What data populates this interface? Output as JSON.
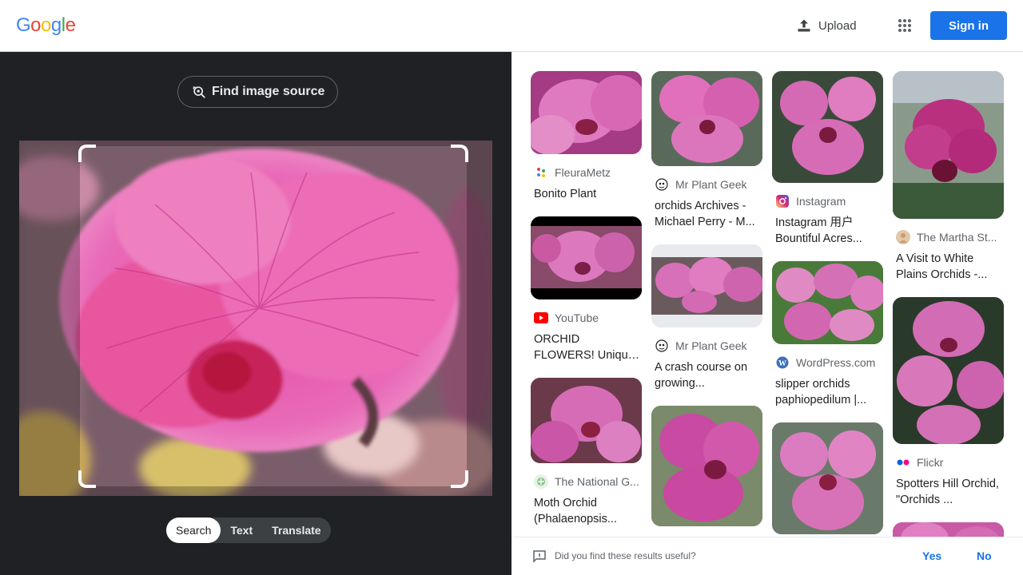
{
  "header": {
    "logo_letters": [
      "G",
      "o",
      "o",
      "g",
      "l",
      "e"
    ],
    "logo_colors": [
      "#4285F4",
      "#EA4335",
      "#FBBC05",
      "#4285F4",
      "#34A853",
      "#EA4335"
    ],
    "upload_label": "Upload",
    "apps_icon": "apps-grid-icon",
    "signin_label": "Sign in"
  },
  "lens": {
    "find_source_label": "Find image source",
    "modes": [
      "Search",
      "Text",
      "Translate"
    ],
    "active_mode": "Search"
  },
  "results": [
    {
      "source": "FleuraMetz",
      "title": "Bonito Plant",
      "fav": "fleurametz-icon"
    },
    {
      "source": "YouTube",
      "title": "ORCHID FLOWERS! Unique! - YouTube",
      "fav": "youtube-icon"
    },
    {
      "source": "The National G...",
      "title": "Moth Orchid (Phalaenopsis...",
      "fav": "national-garden-icon"
    },
    {
      "source": "Mr Plant Geek",
      "title": "orchids Archives - Michael Perry - M...",
      "fav": "mr-plant-geek-icon"
    },
    {
      "source": "Mr Plant Geek",
      "title": "A crash course on growing...",
      "fav": "mr-plant-geek-icon"
    },
    {
      "source": "",
      "title": "",
      "fav": ""
    },
    {
      "source": "Instagram",
      "title": "Instagram 用户 Bountiful Acres...",
      "fav": "instagram-icon"
    },
    {
      "source": "WordPress.com",
      "title": "slipper orchids paphiopedilum |...",
      "fav": "wordpress-icon"
    },
    {
      "source": "",
      "title": "",
      "fav": ""
    },
    {
      "source": "The Martha St...",
      "title": "A Visit to White Plains Orchids -...",
      "fav": "martha-stewart-icon"
    },
    {
      "source": "Flickr",
      "title": "Spotters Hill Orchid, \"Orchids ...",
      "fav": "flickr-icon"
    },
    {
      "source": "",
      "title": "",
      "fav": ""
    }
  ],
  "feedback": {
    "question": "Did you find these results useful?",
    "yes": "Yes",
    "no": "No"
  },
  "colors": {
    "accent": "#1a73e8",
    "dark_panel": "#202124"
  }
}
